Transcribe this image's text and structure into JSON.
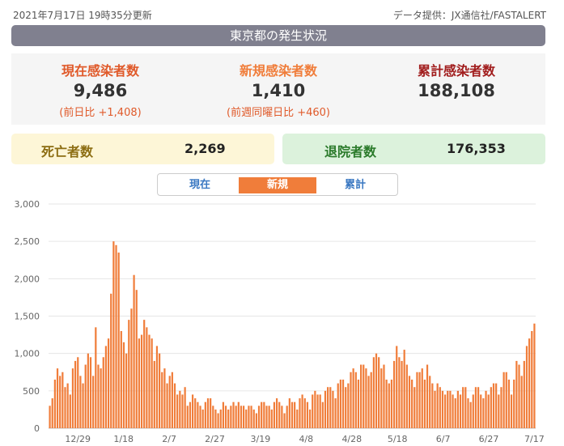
{
  "header": {
    "updated": "2021年7月17日 19時35分更新",
    "source": "データ提供：JX通信社/FASTALERT"
  },
  "title": "東京都の発生状況",
  "stats": {
    "current": {
      "label": "現在感染者数",
      "value": "9,486",
      "diff": "(前日比 +1,408)",
      "color": "#e05a2a"
    },
    "new": {
      "label": "新規感染者数",
      "value": "1,410",
      "diff": "(前週同曜日比 +460)",
      "color": "#f07d3a"
    },
    "total": {
      "label": "累計感染者数",
      "value": "188,108",
      "color": "#a11d1d"
    }
  },
  "deaths": {
    "label": "死亡者数",
    "value": "2,269"
  },
  "recovered": {
    "label": "退院者数",
    "value": "176,353"
  },
  "tabs": [
    {
      "label": "現在",
      "active": false
    },
    {
      "label": "新規",
      "active": true
    },
    {
      "label": "累計",
      "active": false
    }
  ],
  "chart_data": {
    "type": "bar",
    "color": "#f07d3a",
    "ylim": [
      0,
      3000
    ],
    "yticks": [
      "0",
      "500",
      "1,000",
      "1,500",
      "2,000",
      "2,500",
      "3,000"
    ],
    "xtick_labels": [
      "12/29",
      "1/18",
      "2/7",
      "2/27",
      "3/19",
      "4/8",
      "4/28",
      "5/18",
      "6/7",
      "6/27",
      "7/17"
    ],
    "grid": true,
    "values": [
      300,
      400,
      650,
      800,
      700,
      750,
      550,
      600,
      450,
      800,
      900,
      950,
      700,
      600,
      850,
      1000,
      950,
      700,
      1350,
      850,
      800,
      950,
      1100,
      1200,
      1800,
      2500,
      2450,
      2350,
      1300,
      1150,
      1000,
      1450,
      1600,
      2050,
      1850,
      1200,
      1250,
      1450,
      1350,
      1250,
      1200,
      900,
      1100,
      1000,
      750,
      800,
      600,
      700,
      750,
      600,
      450,
      500,
      450,
      550,
      300,
      350,
      450,
      400,
      350,
      300,
      250,
      350,
      400,
      400,
      300,
      250,
      200,
      250,
      350,
      300,
      250,
      300,
      350,
      300,
      350,
      300,
      300,
      250,
      300,
      300,
      250,
      200,
      300,
      350,
      350,
      300,
      300,
      250,
      350,
      400,
      350,
      300,
      200,
      300,
      400,
      350,
      350,
      250,
      400,
      450,
      400,
      350,
      250,
      450,
      500,
      450,
      450,
      350,
      500,
      550,
      550,
      500,
      400,
      600,
      650,
      650,
      550,
      600,
      750,
      800,
      750,
      650,
      850,
      850,
      800,
      700,
      750,
      950,
      1000,
      950,
      800,
      850,
      650,
      600,
      650,
      900,
      1100,
      950,
      900,
      1050,
      850,
      700,
      650,
      550,
      750,
      750,
      800,
      650,
      850,
      700,
      600,
      500,
      600,
      550,
      500,
      450,
      500,
      500,
      450,
      400,
      500,
      450,
      550,
      550,
      400,
      350,
      450,
      550,
      550,
      450,
      400,
      500,
      450,
      550,
      600,
      600,
      450,
      550,
      750,
      750,
      650,
      450,
      650,
      900,
      850,
      700,
      900,
      1100,
      1200,
      1300,
      1400
    ]
  }
}
